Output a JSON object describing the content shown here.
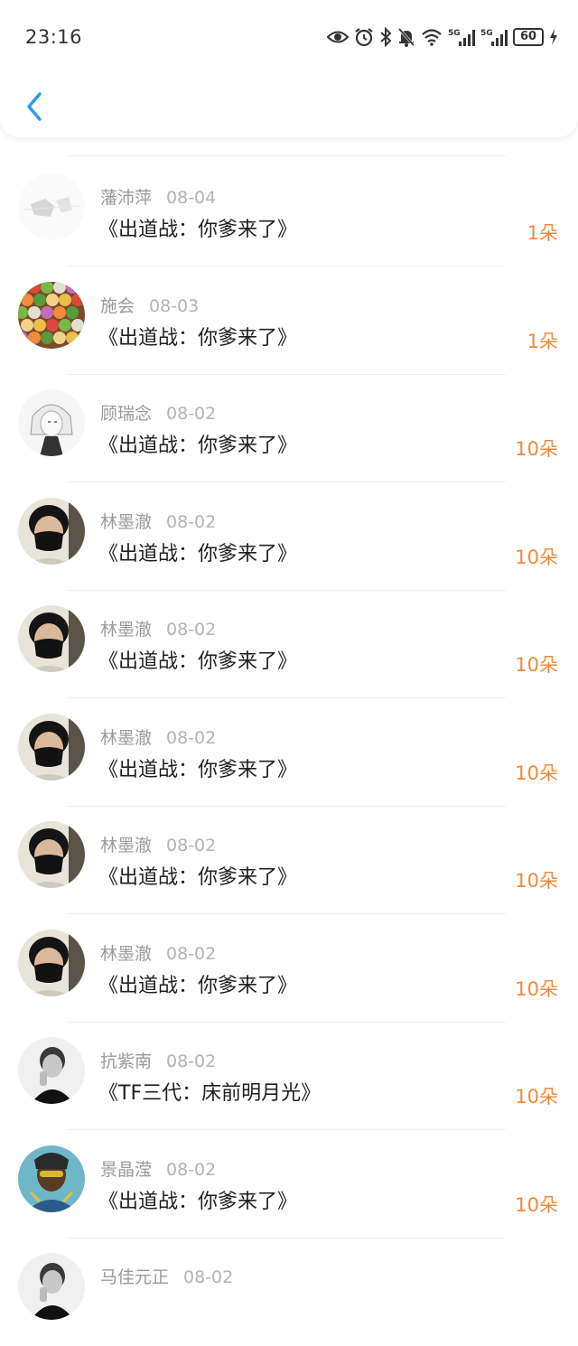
{
  "status_bar": {
    "time": "23:16",
    "battery": "60",
    "icons": [
      "eye-icon",
      "alarm-icon",
      "bluetooth-icon",
      "mute-bell-icon",
      "wifi-icon",
      "signal-5g-icon",
      "signal-5g-icon",
      "battery-icon",
      "charging-icon"
    ]
  },
  "nav": {
    "back_icon": "chevron-left-icon",
    "accent": "#2a9be8"
  },
  "colors": {
    "count": "#f08a3c",
    "name": "#9a9a9a",
    "date": "#b3b3b3"
  },
  "items": [
    {
      "name": "藩沛萍",
      "date": "08-04",
      "title": "《出道战：你爹来了》",
      "count": "1朵",
      "avatar": "sketch"
    },
    {
      "name": "施会",
      "date": "08-03",
      "title": "《出道战：你爹来了》",
      "count": "1朵",
      "avatar": "candy"
    },
    {
      "name": "顾瑞念",
      "date": "08-02",
      "title": "《出道战：你爹来了》",
      "count": "10朵",
      "avatar": "anime"
    },
    {
      "name": "林墨澈",
      "date": "08-02",
      "title": "《出道战：你爹来了》",
      "count": "10朵",
      "avatar": "mask"
    },
    {
      "name": "林墨澈",
      "date": "08-02",
      "title": "《出道战：你爹来了》",
      "count": "10朵",
      "avatar": "mask"
    },
    {
      "name": "林墨澈",
      "date": "08-02",
      "title": "《出道战：你爹来了》",
      "count": "10朵",
      "avatar": "mask"
    },
    {
      "name": "林墨澈",
      "date": "08-02",
      "title": "《出道战：你爹来了》",
      "count": "10朵",
      "avatar": "mask"
    },
    {
      "name": "林墨澈",
      "date": "08-02",
      "title": "《出道战：你爹来了》",
      "count": "10朵",
      "avatar": "mask"
    },
    {
      "name": "抗紫南",
      "date": "08-02",
      "title": "《TF三代：床前明月光》",
      "count": "10朵",
      "avatar": "bw"
    },
    {
      "name": "景晶滢",
      "date": "08-02",
      "title": "《出道战：你爹来了》",
      "count": "10朵",
      "avatar": "colorful"
    },
    {
      "name": "马佳元正",
      "date": "08-02",
      "title": "",
      "count": "",
      "avatar": "bw"
    }
  ]
}
